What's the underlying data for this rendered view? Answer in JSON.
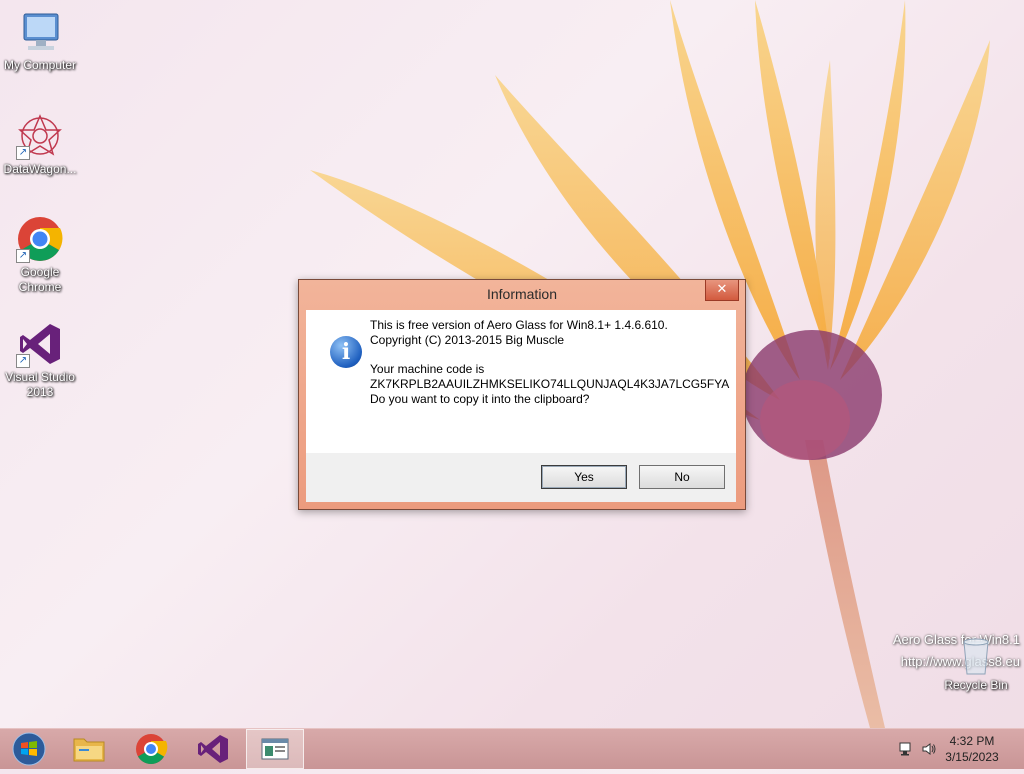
{
  "desktop": {
    "icons": [
      {
        "label": "My Computer",
        "icon": "computer-icon"
      },
      {
        "label": "DataWagon...",
        "icon": "datawagon-icon"
      },
      {
        "label": "Google Chrome",
        "icon": "chrome-icon"
      },
      {
        "label": "Visual Studio 2013",
        "icon": "visual-studio-icon"
      },
      {
        "label": "Recycle Bin",
        "icon": "recycle-bin-icon"
      }
    ],
    "watermark": {
      "line1": "Aero Glass for Win8.1",
      "line2": "http://www.glass8.eu"
    }
  },
  "dialog": {
    "title": "Information",
    "close_label": "✕",
    "line1": "This is free version of Aero Glass for Win8.1+ 1.4.6.610.",
    "line2": "Copyright (C) 2013-2015 Big Muscle",
    "line3": "Your machine code is",
    "line4": "ZK7KRPLB2AAUILZHMKSELIKO74LLQUNJAQL4K3JA7LCG5FYA",
    "line5": "Do you want to copy it into the clipboard?",
    "yes_label": "Yes",
    "no_label": "No",
    "icon": "info-icon"
  },
  "taskbar": {
    "apps": [
      "start-button",
      "file-explorer",
      "chrome",
      "visual-studio",
      "active-window"
    ],
    "clock": {
      "time": "4:32 PM",
      "date": "3/15/2023"
    },
    "colors": {
      "accent": "#c99596",
      "dialog_frame": "#ec9b7e"
    }
  }
}
